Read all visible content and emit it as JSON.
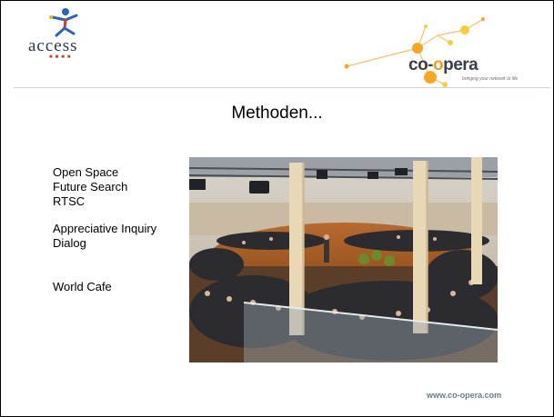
{
  "header": {
    "left_logo_text": "access",
    "right_logo_text_prefix": "co-",
    "right_logo_text_accent": "o",
    "right_logo_text_suffix": "pera",
    "right_logo_tagline": "bringing your network to life"
  },
  "slide": {
    "title": "Methoden...",
    "methods": [
      "Open Space",
      "Future Search",
      "RTSC",
      "Appreciative Inquiry",
      "Dialog",
      "World Cafe"
    ]
  },
  "footer": {
    "url": "www.co-opera.com"
  },
  "colors": {
    "network_orange": "#f7a823",
    "network_yellow": "#f7cf3a",
    "network_line": "#f2c46a",
    "access_dots": "#d23b2c",
    "footer_text": "#6b7b8c"
  }
}
